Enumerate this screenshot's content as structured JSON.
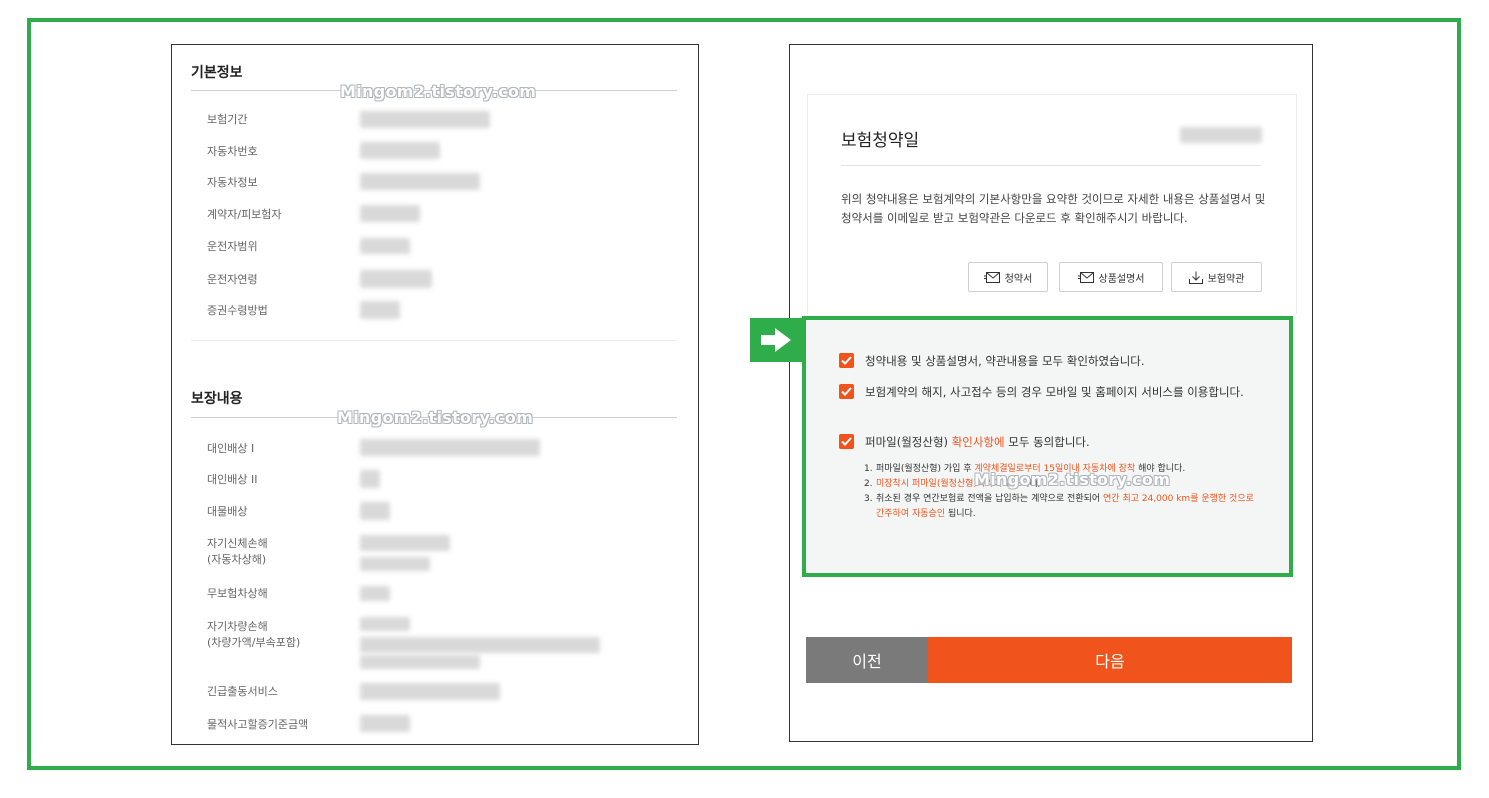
{
  "watermark": "Mingom2.tistory.com",
  "colors": {
    "accent_green": "#2fad4a",
    "accent_orange": "#f0541c",
    "prev_gray": "#7a7a7a"
  },
  "basic_info": {
    "title": "기본정보",
    "rows": [
      "보험기간",
      "자동차번호",
      "자동차정보",
      "계약자/피보험자",
      "운전자범위",
      "운전자연령",
      "증권수령방법"
    ]
  },
  "coverage": {
    "title": "보장내용",
    "rows": [
      "대인배상 I",
      "대인배상 II",
      "대물배상",
      "자기신체손해",
      "(자동차상해)",
      "무보험차상해",
      "자기차량손해",
      "(차량가액/부속포함)",
      "긴급출동서비스",
      "물적사고할증기준금액"
    ]
  },
  "contract": {
    "title": "보험청약일",
    "description": "위의 청약내용은 보험계약의 기본사항만을 요약한 것이므로 자세한 내용은 상품설명서 및 청약서를 이메일로 받고 보험약관은 다운로드 후 확인해주시기 바랍니다.",
    "buttons": {
      "application": "청약서",
      "product_desc": "상품설명서",
      "terms": "보험약관"
    }
  },
  "agreements": {
    "item1": "청약내용 및 상품설명서, 약관내용을 모두 확인하였습니다.",
    "item2": "보험계약의 해지, 사고접수 등의 경우 모바일 및 홈페이지 서비스를 이용합니다.",
    "item3_prefix": "퍼마일(월정산형) ",
    "item3_link": "확인사항에",
    "item3_suffix": " 모두 동의합니다.",
    "sub": [
      {
        "num": "1.",
        "text_plain": "퍼마일(월정산형) 가입 후 ",
        "text_orange": "계약체결일로부터 15일이내 자동차에 장착",
        "text_after": " 해야 합니다."
      },
      {
        "num": "2.",
        "text_orange": "미장착시 퍼마일(월정산형)특약이 취소",
        "text_after": "되며,"
      },
      {
        "num": "3.",
        "text_plain": "취소된 경우 연간보험료 전액을 납입하는 계약으로 전환되어 ",
        "text_orange": "연간 최고 24,000 km를 운행한 것으로 간주하여 자동승인",
        "text_after": " 됩니다."
      }
    ]
  },
  "footer": {
    "prev": "이전",
    "next": "다음"
  }
}
